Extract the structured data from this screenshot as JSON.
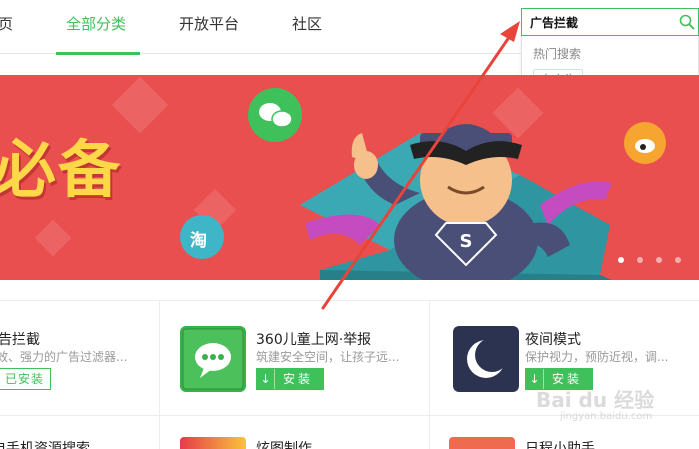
{
  "nav": {
    "items": [
      {
        "label": "页"
      },
      {
        "label": "全部分类"
      },
      {
        "label": "开放平台"
      },
      {
        "label": "社区"
      }
    ],
    "active_index": 1
  },
  "search": {
    "value": "广告拦截",
    "icon": "search-icon",
    "dropdown_title": "热门搜索",
    "hot_tags": [
      "去广告"
    ]
  },
  "banner": {
    "headline": "必备",
    "badges": {
      "taobao": "淘"
    },
    "dots_count": 4,
    "active_dot": 0
  },
  "apps": [
    {
      "name": "告拦截",
      "desc": "效、强力的广告过滤器...",
      "button": "已安装",
      "installed": true
    },
    {
      "name": "360儿童上网·举报",
      "desc": "筑建安全空间，让孩子远...",
      "button": "安装",
      "installed": false
    },
    {
      "name": "夜间模式",
      "desc": "保护视力，预防近视，调...",
      "button": "安装",
      "installed": false
    }
  ],
  "apps_row2": [
    {
      "name": "电手机资源搜索"
    },
    {
      "name": "炫图制作"
    },
    {
      "name": "日程小助手"
    }
  ],
  "watermark": {
    "text": "Bai du 经验",
    "sub": "jingyan.baidu.com"
  },
  "colors": {
    "accent": "#3ec15a",
    "banner_bg": "#ea4f4f",
    "headline": "#ffd84a",
    "arrow": "#e8443a"
  }
}
